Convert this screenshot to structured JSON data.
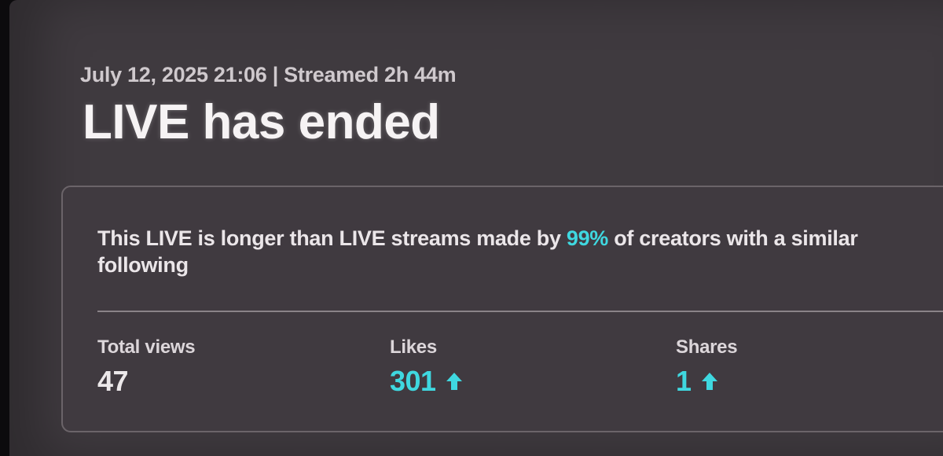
{
  "header": {
    "date_time": "July 12, 2025 21:06",
    "separator": "|",
    "stream_duration": "Streamed 2h 44m",
    "title": "LIVE has ended"
  },
  "insight": {
    "prefix": "This LIVE is longer than LIVE streams made by ",
    "highlight": "99%",
    "suffix": " of creators with a similar following"
  },
  "stats": [
    {
      "label": "Total views",
      "value": "47",
      "trend_icon": null
    },
    {
      "label": "Likes",
      "value": "301",
      "trend_icon": "arrow-up-icon"
    },
    {
      "label": "Shares",
      "value": "1",
      "trend_icon": "arrow-up-icon"
    }
  ],
  "colors": {
    "accent": "#3fd8e0",
    "background": "#3f3a3f",
    "text": "#f6f3f4"
  }
}
